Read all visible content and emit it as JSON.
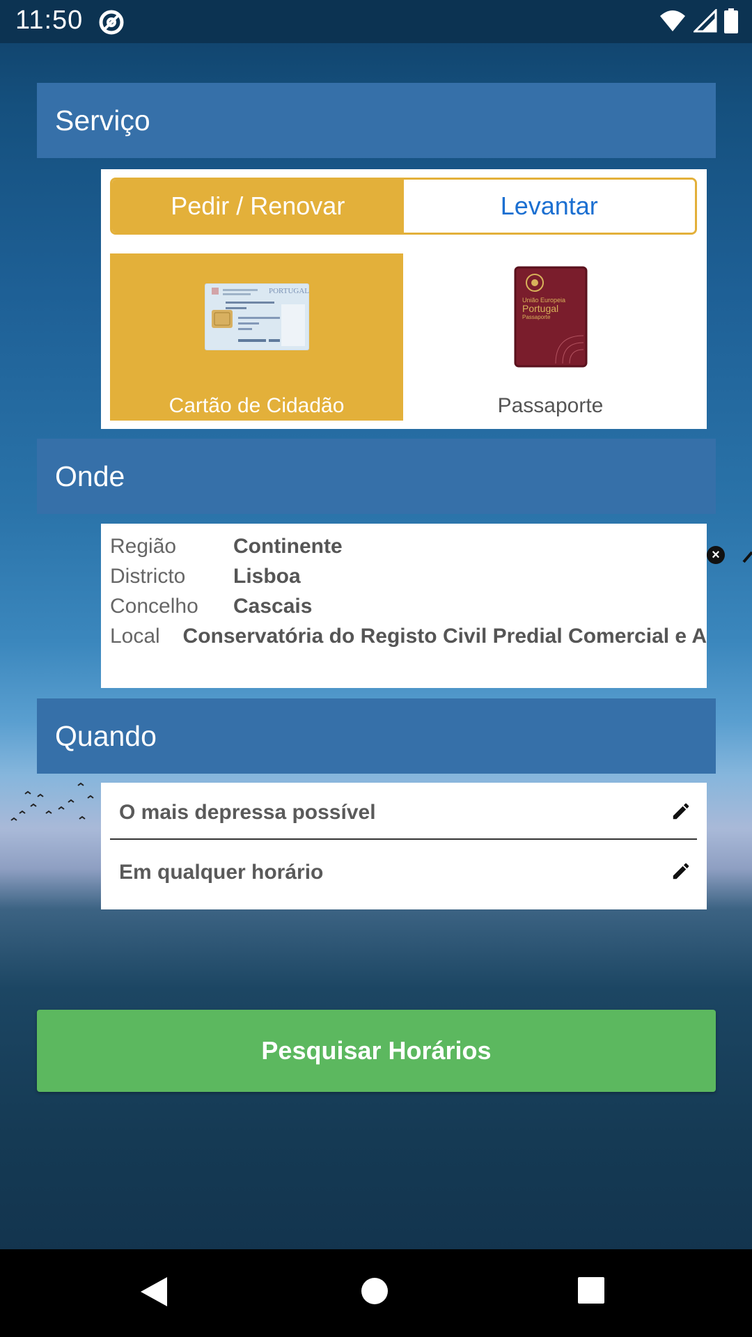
{
  "status_bar": {
    "time": "11:50"
  },
  "sections": {
    "servico": {
      "title": "Serviço",
      "segmented": {
        "active": "Pedir / Renovar",
        "inactive": "Levantar"
      },
      "options": [
        {
          "label": "Cartão de Cidadão",
          "selected": true,
          "icon": "citizen-card-image"
        },
        {
          "label": "Passaporte",
          "selected": false,
          "icon": "passport-image"
        }
      ]
    },
    "onde": {
      "title": "Onde",
      "rows": [
        {
          "label": "Região",
          "value": "Continente"
        },
        {
          "label": "Districto",
          "value": "Lisboa"
        },
        {
          "label": "Concelho",
          "value": "Cascais"
        },
        {
          "label": "Local",
          "value": "Conservatória do Registo Civil Predial Comercial e A"
        }
      ]
    },
    "quando": {
      "title": "Quando",
      "rows": [
        {
          "text": "O mais depressa possível"
        },
        {
          "text": "Em qualquer horário"
        }
      ]
    }
  },
  "search_button": {
    "label": "Pesquisar Horários"
  },
  "colors": {
    "header": "#3670a9",
    "accent": "#e3b03a",
    "link": "#1b6fd1",
    "button": "#5cb85f"
  }
}
